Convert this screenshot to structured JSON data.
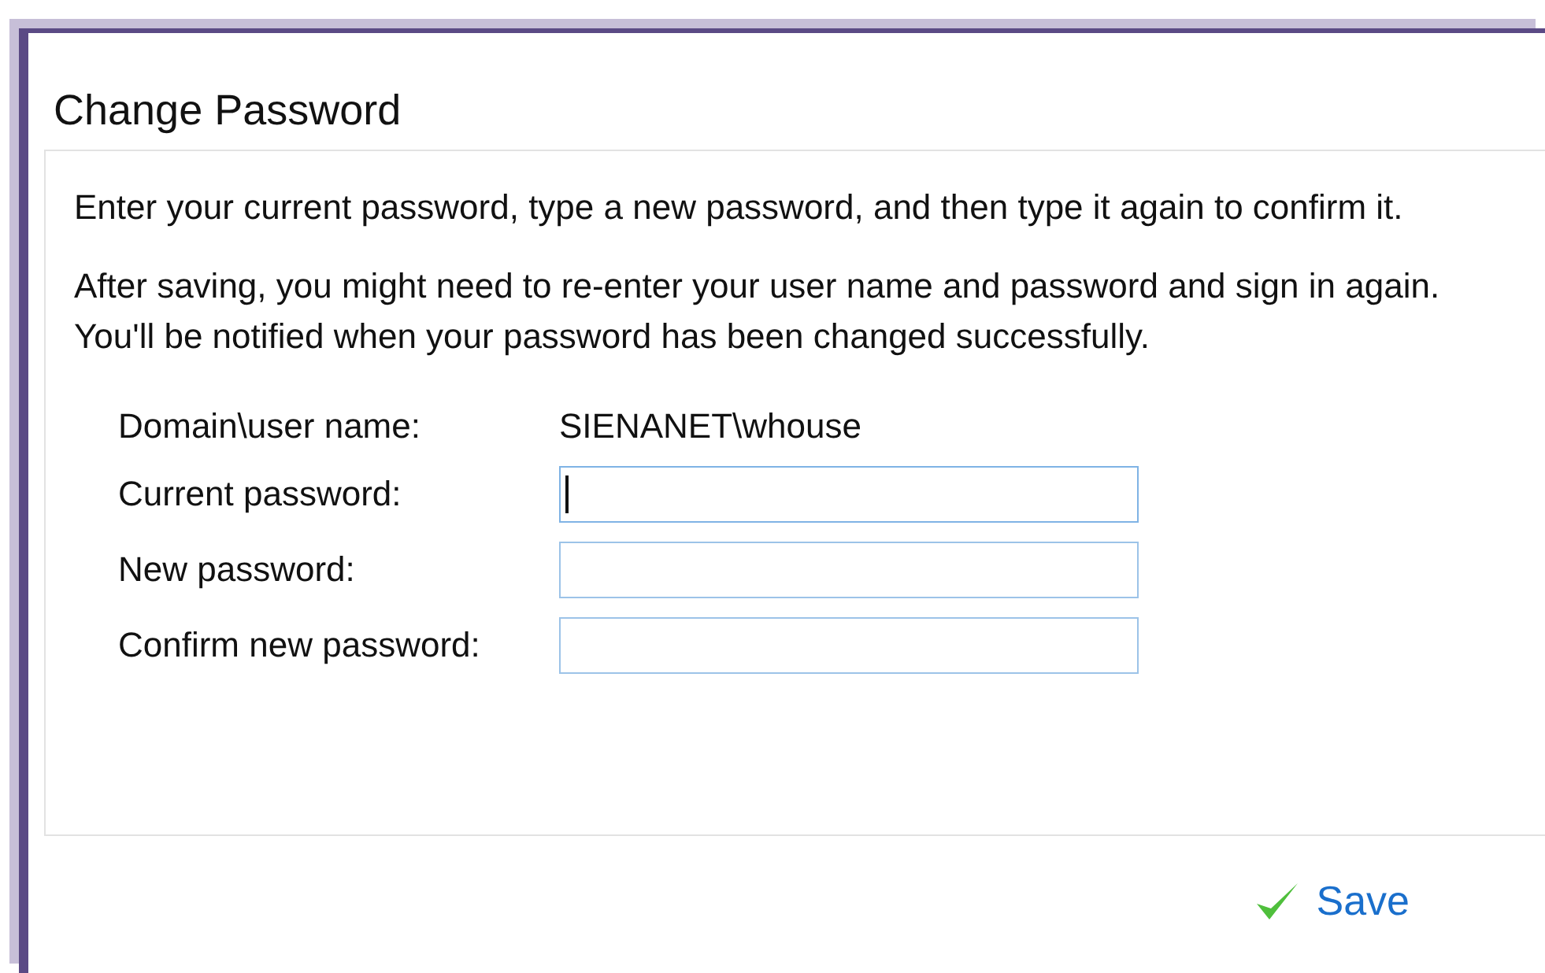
{
  "dialog": {
    "title": "Change Password"
  },
  "paragraphs": [
    "Enter your current password, type a new password, and then type it again to confirm it.",
    "After saving, you might need to re-enter your user name and password and sign in again. You'll be notified when your password has been changed successfully."
  ],
  "fields": [
    {
      "kind": "text",
      "label": "Domain\\user name:",
      "value": "SIENANET\\whouse"
    },
    {
      "kind": "input",
      "label": "Current password:",
      "focused": true
    },
    {
      "kind": "input",
      "label": "New password:",
      "focused": false
    },
    {
      "kind": "input",
      "label": "Confirm new password:",
      "focused": false
    }
  ],
  "buttons": [
    {
      "label": "Save"
    }
  ]
}
